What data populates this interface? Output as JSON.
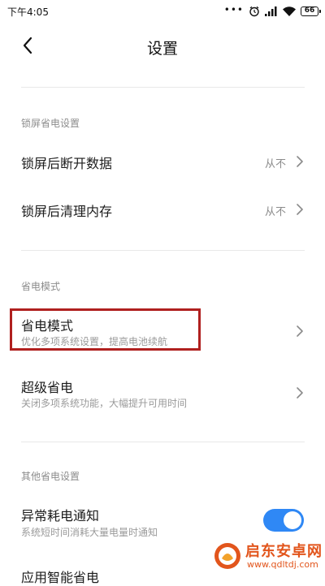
{
  "status_bar": {
    "time": "下午4:05",
    "dots": "•••",
    "battery": "66"
  },
  "header": {
    "title": "设置"
  },
  "sections": [
    {
      "label": "锁屏省电设置",
      "items": [
        {
          "title": "锁屏后断开数据",
          "value": "从不"
        },
        {
          "title": "锁屏后清理内存",
          "value": "从不"
        }
      ]
    },
    {
      "label": "省电模式",
      "items": [
        {
          "title": "省电模式",
          "subtitle": "优化多项系统设置，提高电池续航",
          "highlighted": true
        },
        {
          "title": "超级省电",
          "subtitle": "关闭多项系统功能，大幅提升可用时间"
        }
      ]
    },
    {
      "label": "其他省电设置",
      "items": [
        {
          "title": "异常耗电通知",
          "subtitle": "系统短时间消耗大量电量时通知",
          "toggle_on": true
        },
        {
          "title": "应用智能省电"
        }
      ]
    }
  ],
  "watermark": {
    "title": "启东安卓网",
    "url": "www.qdltdj.com"
  },
  "colors": {
    "toggle_on": "#2f88f5",
    "highlight_border": "#b0201f",
    "watermark": "#e2551c"
  }
}
